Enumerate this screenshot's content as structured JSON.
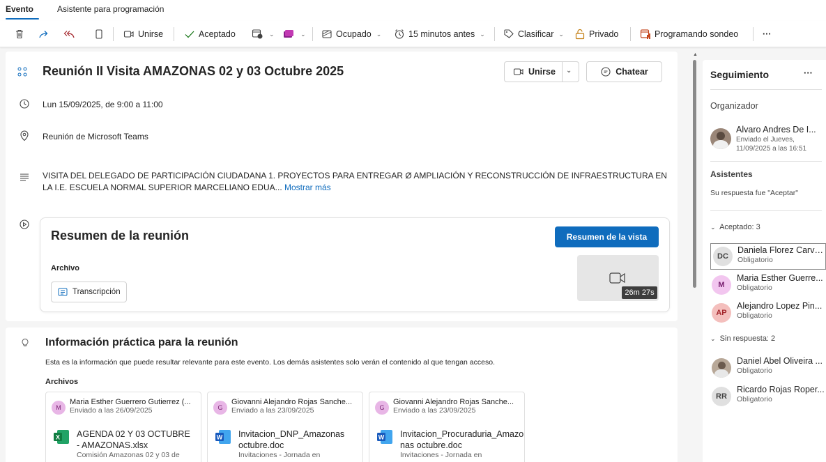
{
  "tabs": {
    "evento": "Evento",
    "asistente": "Asistente para programación"
  },
  "toolbar": {
    "unirse": "Unirse",
    "aceptado": "Aceptado",
    "ocupado": "Ocupado",
    "recordatorio": "15 minutos antes",
    "clasificar": "Clasificar",
    "privado": "Privado",
    "sondeo": "Programando sondeo",
    "more": "···"
  },
  "event": {
    "title": "Reunión II Visita AMAZONAS 02 y 03 Octubre 2025",
    "join_label": "Unirse",
    "chat_label": "Chatear",
    "datetime": "Lun 15/09/2025, de 9:00 a 11:00",
    "location": "Reunión de Microsoft Teams",
    "description": "VISITA DEL DELEGADO DE PARTICIPACIÓN CIUDADANA 1. PROYECTOS PARA ENTREGAR Ø AMPLIACIÓN Y RECONSTRUCCIÓN DE INFRAESTRUCTURA EN LA I.E. ESCUELA NORMAL SUPERIOR MARCELIANO EDUA...",
    "show_more": "Mostrar más"
  },
  "summary": {
    "title": "Resumen de la reunión",
    "view_button": "Resumen de la vista",
    "archivo_label": "Archivo",
    "transcript_chip": "Transcripción",
    "duration": "26m 27s"
  },
  "info": {
    "title": "Información práctica para la reunión",
    "description": "Esta es la información que puede resultar relevante para este evento. Los demás asistentes solo verán el contenido al que tengan acceso.",
    "files_label": "Archivos",
    "files": [
      {
        "initial": "M",
        "sender": "Maria Esther Guerrero Gutierrez (...",
        "sent": "Enviado a las 26/09/2025",
        "type": "excel",
        "name": "AGENDA 02 Y 03 OCTUBRE - AMAZONAS.xlsx",
        "location": "Comisión Amazonas 02 y 03 de"
      },
      {
        "initial": "G",
        "sender": "Giovanni Alejandro Rojas Sanche...",
        "sent": "Enviado a las 23/09/2025",
        "type": "word",
        "name": "Invitacion_DNP_Amazonas octubre.doc",
        "location": "Invitaciones - Jornada en"
      },
      {
        "initial": "G",
        "sender": "Giovanni Alejandro Rojas Sanche...",
        "sent": "Enviado a las 23/09/2025",
        "type": "word",
        "name": "Invitacion_Procuraduria_Amazonas octubre.doc",
        "location": "Invitaciones - Jornada en"
      }
    ]
  },
  "tracking": {
    "title": "Seguimiento",
    "more": "···",
    "organizer_label": "Organizador",
    "organizer": {
      "name": "Alvaro Andres De I...",
      "sent_line1": "Enviado el Jueves,",
      "sent_line2": "11/09/2025 a las 16:51"
    },
    "attendees_label": "Asistentes",
    "response_text": "Su respuesta fue \"Aceptar\"",
    "accepted_label": "Aceptado: 3",
    "accepted": [
      {
        "initials": "DC",
        "name": "Daniela Florez Carva...",
        "role": "Obligatorio",
        "bg": "#e0e0e0",
        "fg": "#424242"
      },
      {
        "initials": "M",
        "name": "Maria Esther Guerre...",
        "role": "Obligatorio",
        "bg": "#f2c6ef",
        "fg": "#7a2272"
      },
      {
        "initials": "AP",
        "name": "Alejandro Lopez Pin...",
        "role": "Obligatorio",
        "bg": "#f4bfbd",
        "fg": "#a4262c"
      }
    ],
    "no_response_label": "Sin respuesta: 2",
    "no_response": [
      {
        "initials": "",
        "name": "Daniel Abel Oliveira ...",
        "role": "Obligatorio",
        "bg": "#b8a898",
        "fg": "#fff"
      },
      {
        "initials": "RR",
        "name": "Ricardo Rojas Roper...",
        "role": "Obligatorio",
        "bg": "#e0e0e0",
        "fg": "#424242"
      }
    ]
  }
}
